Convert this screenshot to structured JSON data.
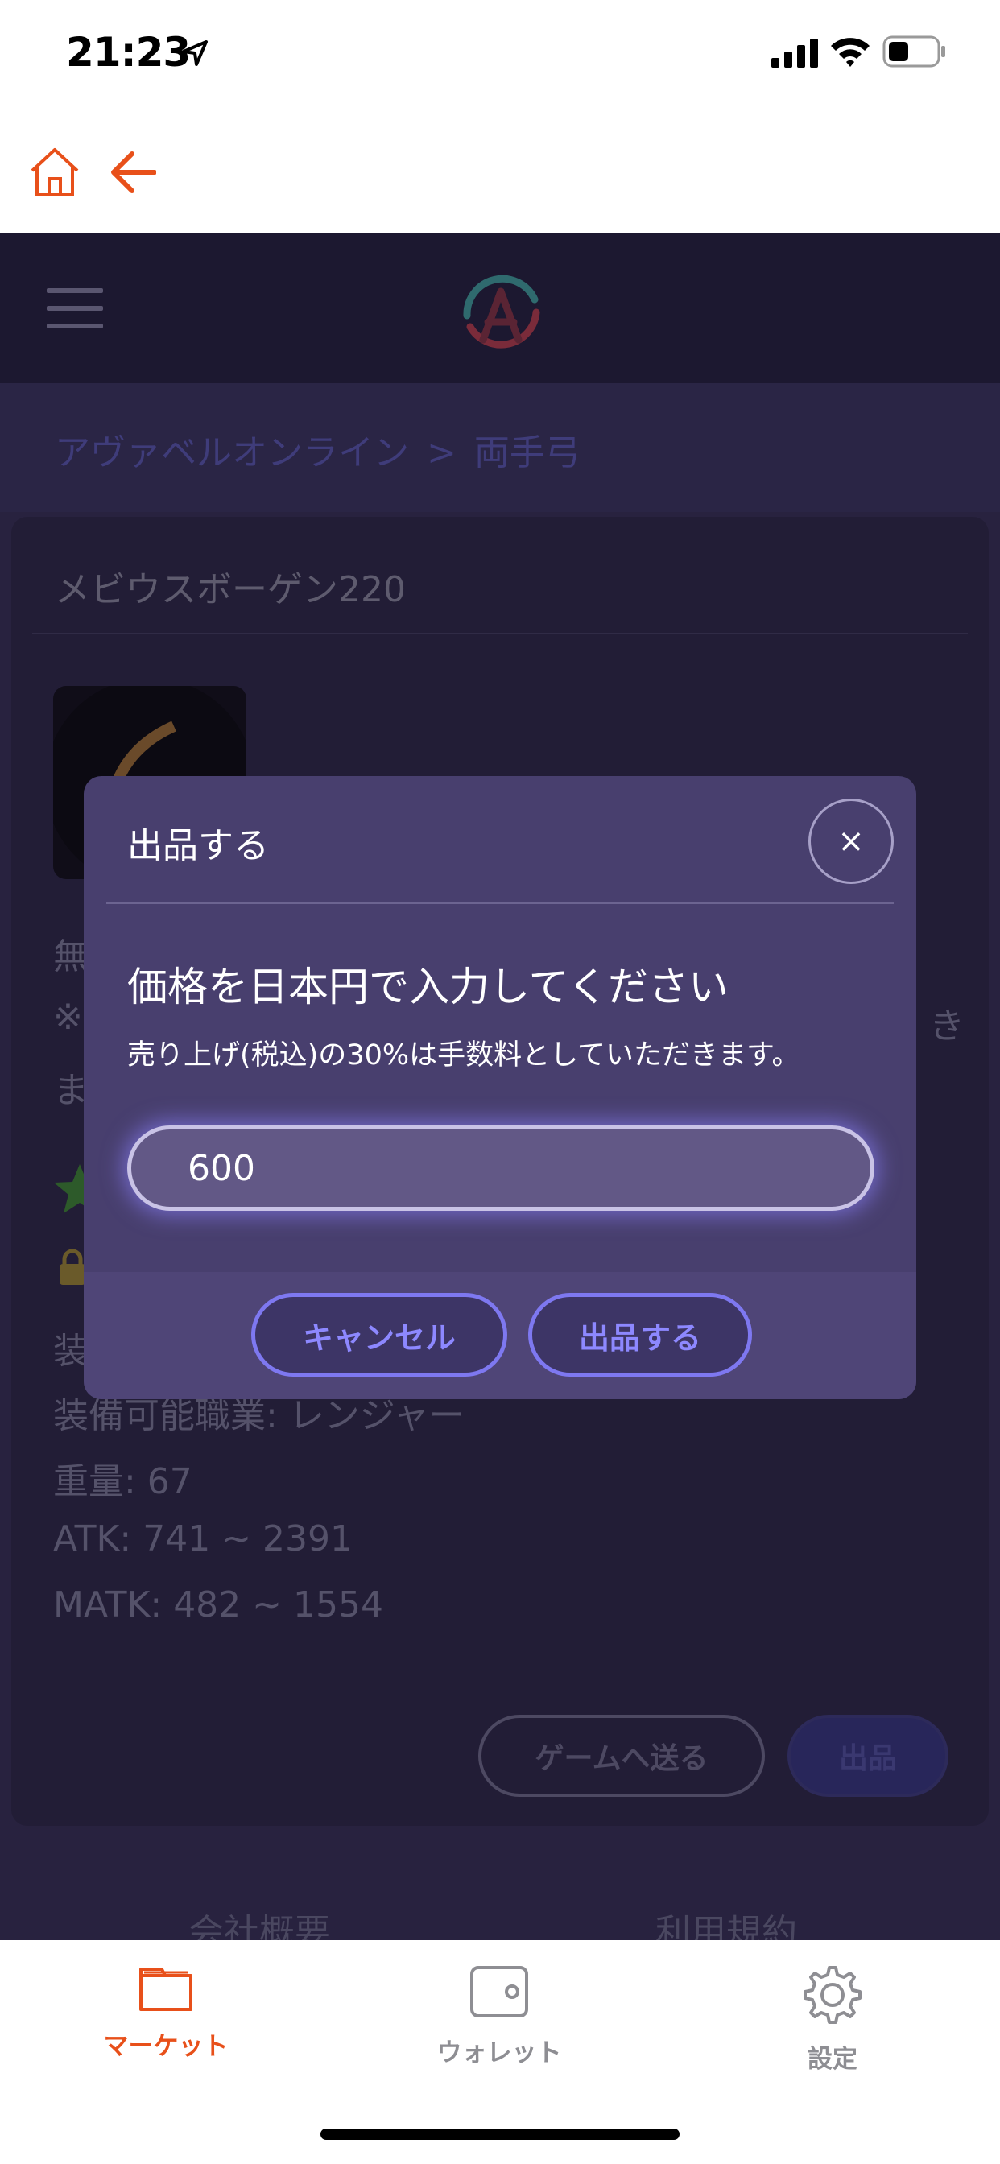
{
  "status_bar": {
    "time": "21:23"
  },
  "breadcrumb": {
    "parent": "アヴァベルオンライン",
    "separator": ">",
    "current": "両手弓"
  },
  "item": {
    "name": "メビウスボーゲン220",
    "partial_line_1": "無",
    "partial_line_2": "※",
    "partial_line_2_right": "き",
    "partial_line_3": "ま",
    "partial_line_4": "装",
    "job": "装備可能職業: レンジャー",
    "weight": "重量: 67",
    "atk": "ATK: 741 ~ 2391",
    "matk": "MATK: 482 ~ 1554"
  },
  "card_actions": {
    "send_label": "ゲームへ送る",
    "list_label": "出品"
  },
  "footer": {
    "company": "会社概要",
    "terms": "利用規約"
  },
  "modal": {
    "title": "出品する",
    "close_glyph": "×",
    "heading": "価格を日本円で入力してください",
    "note": "売り上げ(税込)の30%は手数料としていただきます。",
    "price_value": "600",
    "cancel_label": "キャンセル",
    "submit_label": "出品する"
  },
  "tab_bar": {
    "tabs": [
      {
        "label": "マーケット",
        "icon": "folder-icon",
        "active": true
      },
      {
        "label": "ウォレット",
        "icon": "wallet-icon",
        "active": false
      },
      {
        "label": "設定",
        "icon": "gear-icon",
        "active": false
      }
    ]
  },
  "colors": {
    "accent": "#e8501a",
    "modal_bg": "#483f6e",
    "button_border": "#7e78f0"
  }
}
